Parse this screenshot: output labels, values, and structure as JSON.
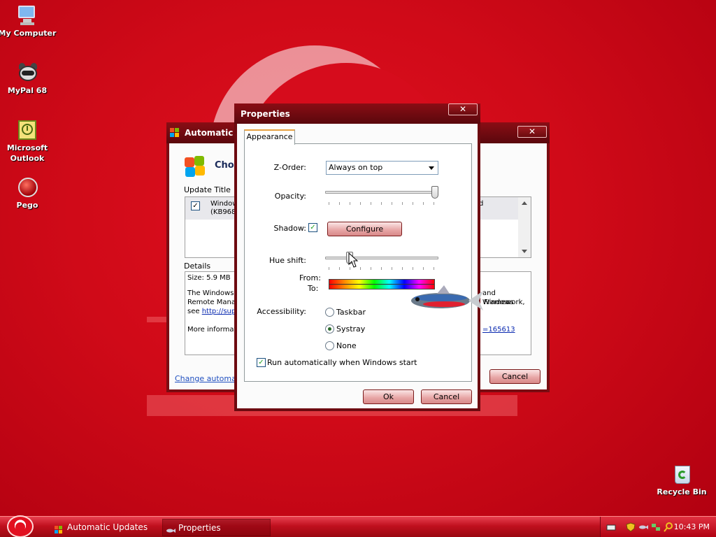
{
  "desktop": {
    "icons": [
      {
        "label": "My Computer",
        "icon": "computer-icon"
      },
      {
        "label": "MyPal 68",
        "icon": "raccoon-browser-icon"
      },
      {
        "label": "Microsoft\nOutlook",
        "label_line1": "Microsoft",
        "label_line2": "Outlook",
        "icon": "outlook-icon"
      },
      {
        "label": "Pego",
        "icon": "pego-icon"
      },
      {
        "label": "Recycle Bin",
        "icon": "recycle-bin-icon"
      }
    ]
  },
  "background_window": {
    "title": "Automatic Up",
    "heading": "Cho",
    "update_title_header": "Update Title",
    "update_row": {
      "text_line1": "Window",
      "text_line2": "(KB968",
      "right_fragment": "d",
      "checked": true
    },
    "details_header": "Details",
    "details": {
      "size": "Size: 5.9 MB",
      "line1_left": "The Windows",
      "line1_right": "and Windows",
      "line2_left": "Remote Manag",
      "line2_right": "Framework,",
      "line3_prefix": "see ",
      "line3_link": "http://sup",
      "more_info": "More informati",
      "more_link": "=165613"
    },
    "change_link": "Change automati",
    "cancel_label": "Cancel"
  },
  "properties": {
    "title": "Properties",
    "close_label": "✕",
    "tab": "Appearance",
    "z_order": {
      "label": "Z-Order:",
      "value": "Always on top"
    },
    "opacity": {
      "label": "Opacity:",
      "value": 1.0
    },
    "shadow": {
      "label": "Shadow:",
      "checked": true,
      "configure_label": "Configure"
    },
    "hue_shift": {
      "label": "Hue shift:",
      "value": 0.2
    },
    "from_label": "From:",
    "to_label": "To:",
    "accessibility": {
      "label": "Accessibility:",
      "options": [
        "Taskbar",
        "Systray",
        "None"
      ],
      "selected": "Systray"
    },
    "run_auto": {
      "label": "Run automatically when Windows start",
      "checked": true
    },
    "ok_label": "Ok",
    "cancel_label": "Cancel"
  },
  "taskbar": {
    "buttons": [
      {
        "label": "Automatic Updates",
        "icon": "windows-logo-icon",
        "active": false
      },
      {
        "label": "Properties",
        "icon": "fish-icon",
        "active": true
      }
    ],
    "clock": "10:43 PM",
    "tray_icons": [
      "keyboard-icon",
      "shield-icon",
      "fish-tray-icon",
      "network-icon",
      "search-tray-icon"
    ]
  },
  "colors": {
    "desktop_red": "#d60c1c",
    "titlebar": "#6d0a10",
    "button_pink": "#e8a8a8"
  }
}
